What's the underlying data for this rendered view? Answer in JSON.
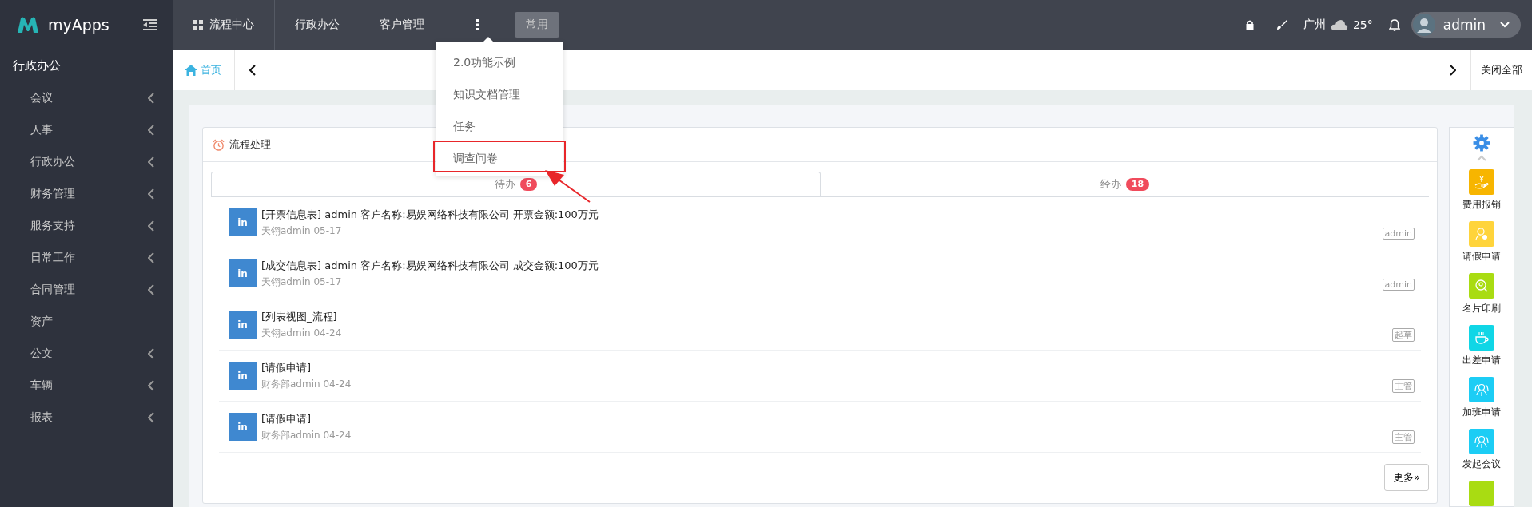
{
  "brand": "myApps",
  "nav": [
    {
      "label": "流程中心"
    },
    {
      "label": "行政办公"
    },
    {
      "label": "客户管理"
    }
  ],
  "quick_button": "常用",
  "header": {
    "city": "广州",
    "temperature": "25°",
    "user": "admin"
  },
  "dropdown": [
    {
      "label": "2.0功能示例",
      "highlighted": false
    },
    {
      "label": "知识文档管理",
      "highlighted": false
    },
    {
      "label": "任务",
      "highlighted": false
    },
    {
      "label": "调查问卷",
      "highlighted": true
    }
  ],
  "sidebar": {
    "title": "行政办公",
    "items": [
      {
        "label": "会议",
        "expandable": true
      },
      {
        "label": "人事",
        "expandable": true
      },
      {
        "label": "行政办公",
        "expandable": true
      },
      {
        "label": "财务管理",
        "expandable": true
      },
      {
        "label": "服务支持",
        "expandable": true
      },
      {
        "label": "日常工作",
        "expandable": true
      },
      {
        "label": "合同管理",
        "expandable": true
      },
      {
        "label": "资产",
        "expandable": false
      },
      {
        "label": "公文",
        "expandable": true
      },
      {
        "label": "车辆",
        "expandable": true
      },
      {
        "label": "报表",
        "expandable": true
      }
    ]
  },
  "page_tabs": {
    "home": "首页",
    "close_all": "关闭全部"
  },
  "card": {
    "title": "流程处理",
    "tabs": [
      {
        "label": "待办",
        "count": "6",
        "selected": true
      },
      {
        "label": "经办",
        "count": "18",
        "selected": false
      }
    ],
    "items": [
      {
        "icon_text": "in",
        "title": "[开票信息表] admin 客户名称:易娱网络科技有限公司 开票金额:100万元",
        "meta": "天翎admin 05-17",
        "tag": "admin"
      },
      {
        "icon_text": "in",
        "title": "[成交信息表] admin 客户名称:易娱网络科技有限公司 成交金额:100万元",
        "meta": "天翎admin 05-17",
        "tag": "admin"
      },
      {
        "icon_text": "in",
        "title": "[列表视图_流程]",
        "meta": "天翎admin 04-24",
        "tag": "起草"
      },
      {
        "icon_text": "in",
        "title": "[请假申请]",
        "meta": "财务部admin 04-24",
        "tag": "主管"
      },
      {
        "icon_text": "in",
        "title": "[请假申请]",
        "meta": "财务部admin 04-24",
        "tag": "主管"
      }
    ],
    "more": "更多»"
  },
  "shortcuts": [
    {
      "kind": "hand",
      "label": "费用报销",
      "color": "#f7b500"
    },
    {
      "kind": "person",
      "label": "请假申请",
      "color": "#ffd43b"
    },
    {
      "kind": "search",
      "label": "名片印刷",
      "color": "#a9dc12"
    },
    {
      "kind": "cup",
      "label": "出差申请",
      "color": "#10d6e6"
    },
    {
      "kind": "group",
      "label": "加班申请",
      "color": "#1ccdf5"
    },
    {
      "kind": "group",
      "label": "发起会议",
      "color": "#1ccdf5"
    },
    {
      "kind": "cutoff",
      "color": "#a9dc12"
    }
  ]
}
